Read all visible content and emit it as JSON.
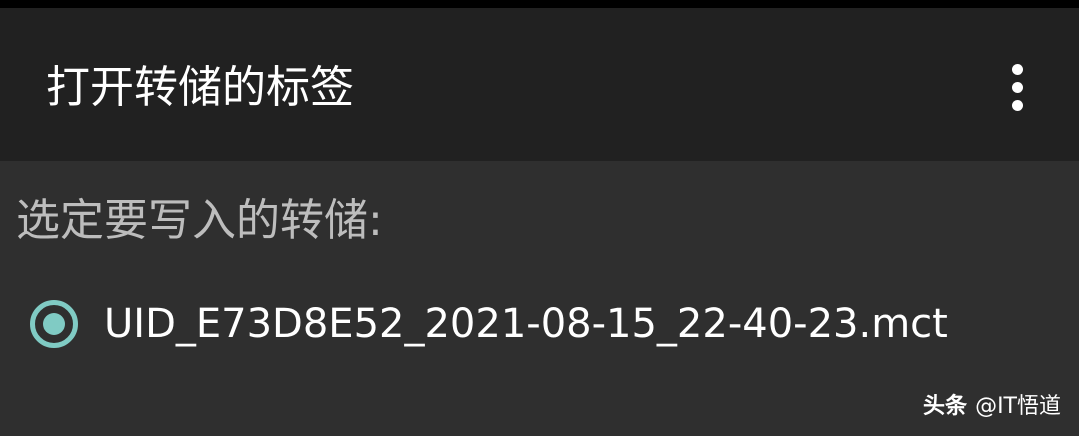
{
  "toolbar": {
    "title": "打开转储的标签",
    "overflow_icon": "more-vert-icon"
  },
  "dialog": {
    "prompt": "选定要写入的转储:",
    "options": [
      {
        "label": "UID_E73D8E52_2021-08-15_22-40-23.mct",
        "selected": true
      }
    ]
  },
  "watermark": {
    "brand": "头条",
    "handle": "@IT悟道"
  },
  "colors": {
    "toolbar_bg": "#212121",
    "content_bg": "#2f2f2f",
    "accent": "#80cbc4",
    "prompt_text": "#bdbdbd"
  }
}
